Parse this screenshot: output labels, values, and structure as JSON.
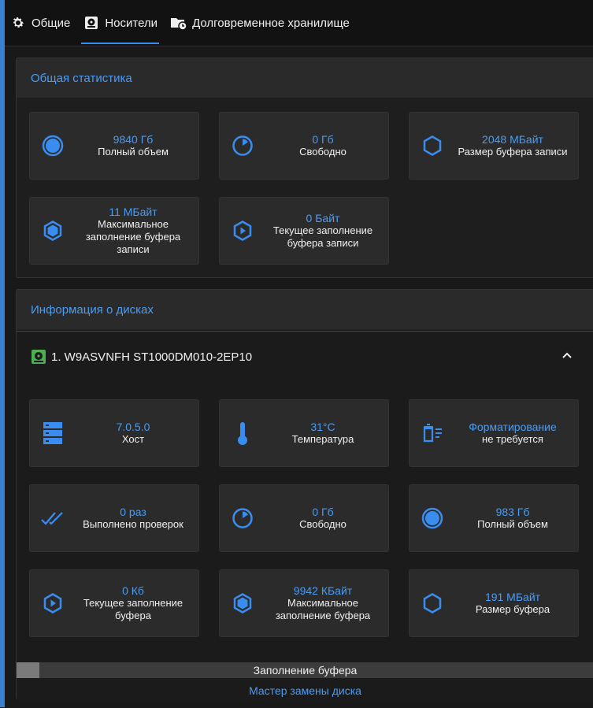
{
  "tabs": [
    {
      "label": "Общие",
      "icon": "gear-icon"
    },
    {
      "label": "Носители",
      "icon": "drive-icon"
    },
    {
      "label": "Долговременное хранилище",
      "icon": "archive-clock-icon"
    }
  ],
  "active_tab": "Носители",
  "accent_color": "#4a9cf5",
  "stats": {
    "title": "Общая статистика",
    "cards": [
      {
        "value": "9840 Гб",
        "label": "Полный объем",
        "icon": "full-circle-icon"
      },
      {
        "value": "0 Гб",
        "label": "Свободно",
        "icon": "pie-empty-icon"
      },
      {
        "value": "2048 МБайт",
        "label": "Размер буфера записи",
        "icon": "hexagon-outline-icon"
      },
      {
        "value": "11 МБайт",
        "label": "Максимальное заполнение буфера записи",
        "icon": "hexagon-filled-icon"
      },
      {
        "value": "0 Байт",
        "label": "Текущее заполнение буфера записи",
        "icon": "hexagon-play-icon"
      }
    ]
  },
  "disks": {
    "title": "Информация о дисках",
    "disk": {
      "name": "1. W9ASVNFH ST1000DM010-2EP10",
      "cards": [
        {
          "value": "7.0.5.0",
          "label": "Хост",
          "icon": "server-icon"
        },
        {
          "value": "31°C",
          "label": "Температура",
          "icon": "thermometer-icon"
        },
        {
          "value": "Форматирование",
          "label": "не требуется",
          "icon": "format-icon"
        },
        {
          "value": "0 раз",
          "label": "Выполнено проверок",
          "icon": "double-check-icon"
        },
        {
          "value": "0 Гб",
          "label": "Свободно",
          "icon": "pie-empty-icon"
        },
        {
          "value": "983 Гб",
          "label": "Полный объем",
          "icon": "full-circle-icon"
        },
        {
          "value": "0 Кб",
          "label": "Текущее заполнение буфера",
          "icon": "hexagon-play-icon"
        },
        {
          "value": "9942 КБайт",
          "label": "Максимальное заполнение буфера",
          "icon": "hexagon-filled-icon"
        },
        {
          "value": "191 МБайт",
          "label": "Размер буфера",
          "icon": "hexagon-outline-icon"
        }
      ],
      "buffer_label": "Заполнение буфера",
      "buffer_fill_fraction": 0.04,
      "replace_wizard": "Мастер замены диска"
    }
  }
}
